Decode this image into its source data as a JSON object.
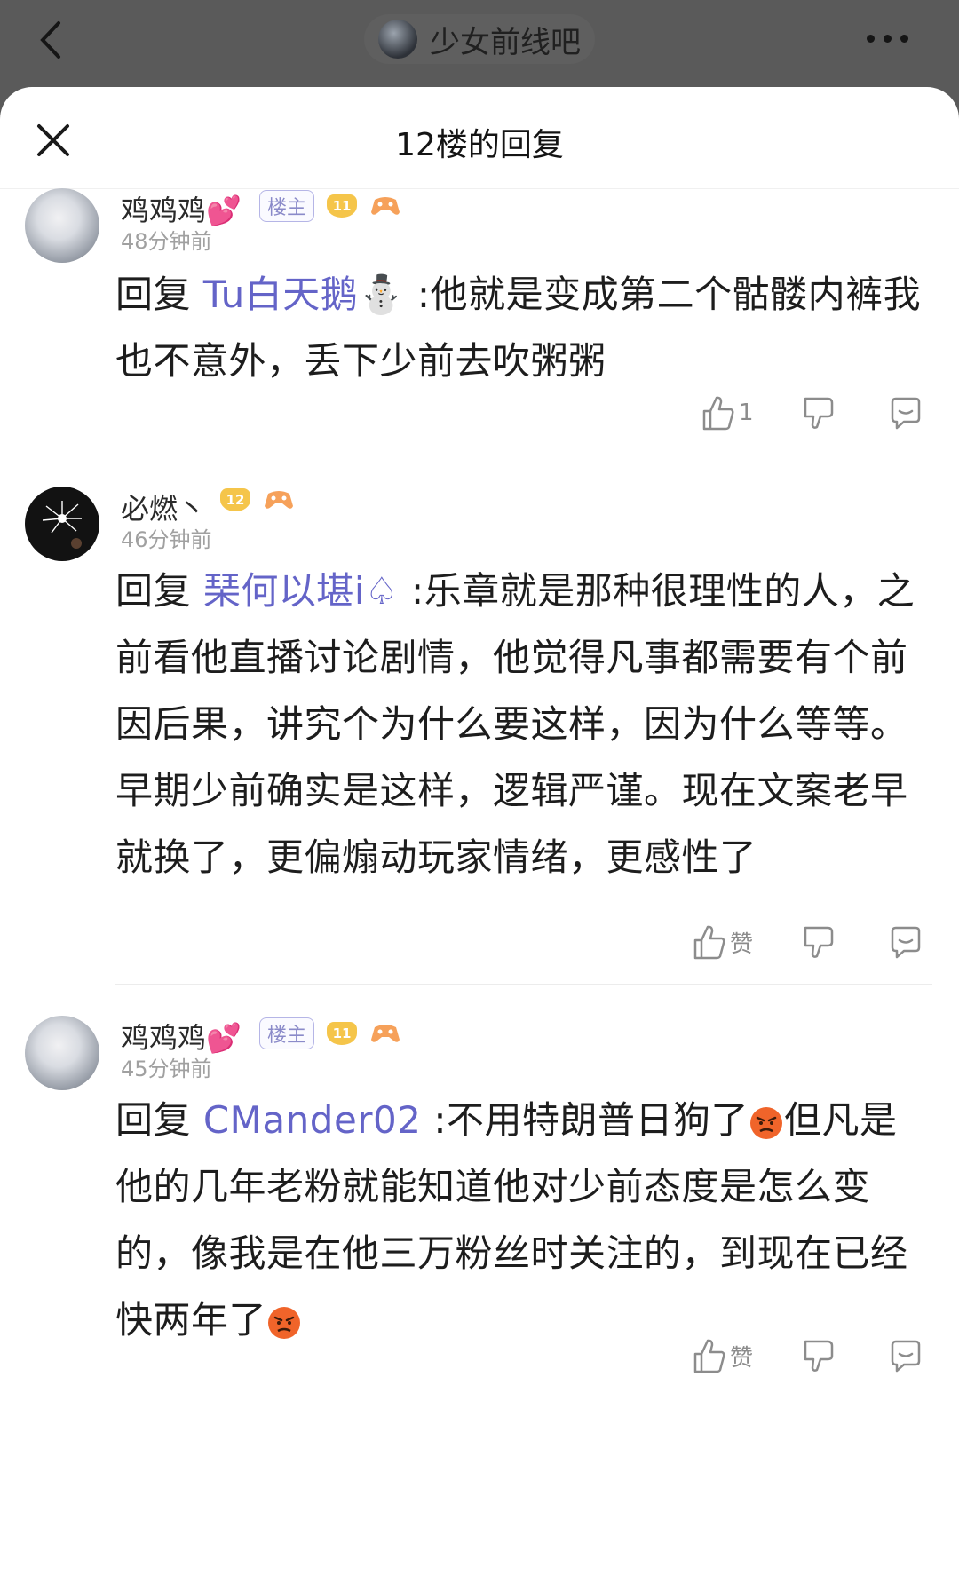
{
  "topbar": {
    "forum_name": "少女前线吧"
  },
  "sheet": {
    "title": "12楼的回复"
  },
  "replies": [
    {
      "username": "鸡鸡鸡💕",
      "is_op": true,
      "op_label": "楼主",
      "level": "11",
      "time": "48分钟前",
      "reply_prefix": "回复 ",
      "mention": "Tu白天鹅⛄",
      "text": " :他就是变成第二个骷髅内裤我也不意外，丢下少前去吹粥粥",
      "like_label": "1"
    },
    {
      "username": "必燃丶",
      "is_op": false,
      "level": "12",
      "time": "46分钟前",
      "reply_prefix": "回复 ",
      "mention": "琹何以堪i♤",
      "text": " :乐章就是那种很理性的人，之前看他直播讨论剧情，他觉得凡事都需要有个前因后果，讲究个为什么要这样，因为什么等等。早期少前确实是这样，逻辑严谨。现在文案老早就换了，更偏煽动玩家情绪，更感性了",
      "like_label": "赞"
    },
    {
      "username": "鸡鸡鸡💕",
      "is_op": true,
      "op_label": "楼主",
      "level": "11",
      "time": "45分钟前",
      "reply_prefix": "回复 ",
      "mention": "CMander02",
      "text_a": " :不用特朗普日狗了",
      "text_b": "但凡是他的几年老粉就能知道他对少前态度是怎么变的，像我是在他三万粉丝时关注的，到现在已经快两年了",
      "like_label": "赞"
    }
  ],
  "colors": {
    "mention": "#6464c8",
    "op_badge": "#8a8ac9",
    "level_badge": "#f5c54a"
  }
}
